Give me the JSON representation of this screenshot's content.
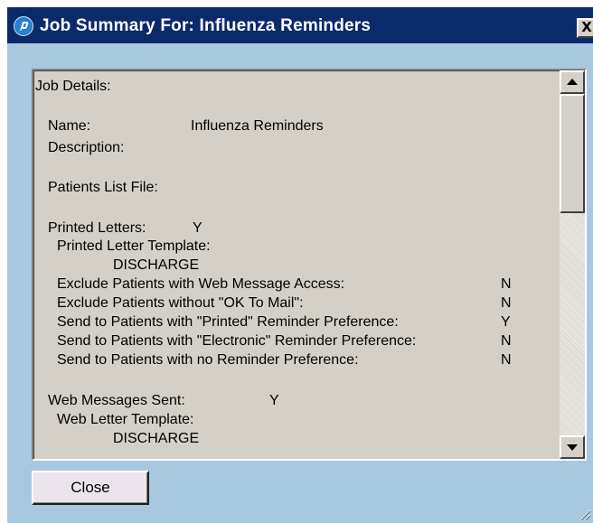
{
  "window": {
    "title": "Job Summary For: Influenza Reminders",
    "close_glyph": "X",
    "title_bar_color": "#0b2a6b",
    "background_color": "#a8c8e0"
  },
  "details": {
    "header": "Job Details:",
    "name_label": "Name:",
    "name_value": "Influenza Reminders",
    "description_label": "Description:",
    "patients_list_label": "Patients List File:",
    "printed_letters_label": "Printed Letters:",
    "printed_letters_value": "Y",
    "printed_template_label": "Printed Letter Template:",
    "printed_template_value": "DISCHARGE",
    "options": [
      {
        "label": "Exclude Patients with Web Message Access:",
        "value": "N"
      },
      {
        "label": "Exclude Patients without \"OK To Mail\":",
        "value": "N"
      },
      {
        "label": "Send to Patients with \"Printed\" Reminder Preference:",
        "value": "Y"
      },
      {
        "label": "Send to Patients with \"Electronic\" Reminder Preference:",
        "value": "N"
      },
      {
        "label": "Send to Patients with no Reminder Preference:",
        "value": "N"
      }
    ],
    "web_messages_label": "Web Messages Sent:",
    "web_messages_value": "Y",
    "web_template_label": "Web Letter Template:",
    "web_template_value": "DISCHARGE"
  },
  "buttons": {
    "close_label": "Close"
  },
  "icons": {
    "app": "app-logo-icon",
    "window_close": "close-icon",
    "scroll_up": "arrow-up-icon",
    "scroll_down": "arrow-down-icon",
    "resize": "resize-grip-icon"
  }
}
